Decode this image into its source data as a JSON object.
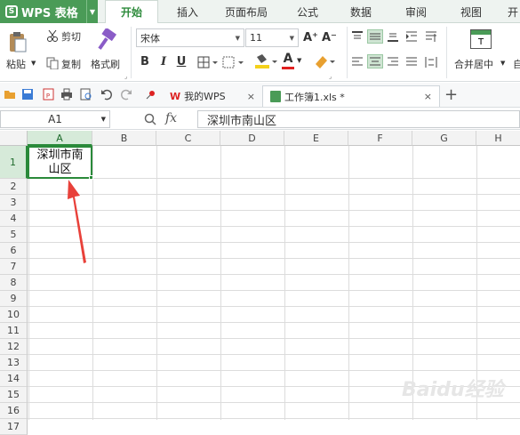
{
  "app": {
    "name": "WPS 表格",
    "logo_letter": "S"
  },
  "menus": [
    "开始",
    "插入",
    "页面布局",
    "公式",
    "数据",
    "审阅",
    "视图",
    "开"
  ],
  "active_menu": "开始",
  "clipboard": {
    "cut": "剪切",
    "paste": "粘贴",
    "copy": "复制",
    "format_painter": "格式刷"
  },
  "font": {
    "name": "宋体",
    "size": "11"
  },
  "format_buttons": {
    "bold": "B",
    "italic": "I",
    "underline": "U",
    "grow": "A⁺",
    "shrink": "A⁻",
    "font_color": "A"
  },
  "merge": {
    "label": "合并居中",
    "partial": "自"
  },
  "tabs": [
    {
      "label": "我的WPS",
      "close": "×"
    },
    {
      "label": "工作簿1.xls *",
      "close": "×"
    }
  ],
  "new_tab": "+",
  "name_box": "A1",
  "fx_label": "fx",
  "formula_value": "深圳市南山区",
  "columns": [
    "A",
    "B",
    "C",
    "D",
    "E",
    "F",
    "G",
    "H"
  ],
  "rows": [
    "1",
    "2",
    "3",
    "4",
    "5",
    "6",
    "7",
    "8",
    "9",
    "10",
    "11",
    "12",
    "13",
    "14",
    "15",
    "16",
    "17"
  ],
  "cell_a1": {
    "line1": "深圳市南",
    "line2": "山区"
  },
  "colors": {
    "accent": "#2e8b3c",
    "app_green": "#4a9b57",
    "selection": "#2a8a3a",
    "arrow": "#e8413a"
  },
  "watermark": "Baidu经验"
}
